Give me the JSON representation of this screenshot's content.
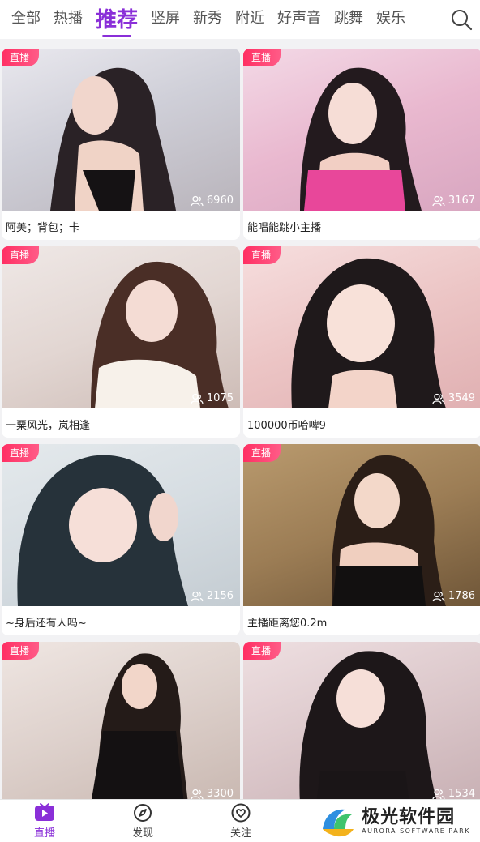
{
  "tabs": [
    {
      "label": "全部",
      "active": false
    },
    {
      "label": "热播",
      "active": false
    },
    {
      "label": "推荐",
      "active": true
    },
    {
      "label": "竖屏",
      "active": false
    },
    {
      "label": "新秀",
      "active": false
    },
    {
      "label": "附近",
      "active": false
    },
    {
      "label": "好声音",
      "active": false
    },
    {
      "label": "跳舞",
      "active": false
    },
    {
      "label": "娱乐",
      "active": false
    }
  ],
  "cards": [
    {
      "badge": "直播",
      "viewers": "6960",
      "title": "阿美；背包；卡"
    },
    {
      "badge": "直播",
      "viewers": "3167",
      "title": "能唱能跳小主播"
    },
    {
      "badge": "直播",
      "viewers": "1075",
      "title": "一粟风光，岚相逢"
    },
    {
      "badge": "直播",
      "viewers": "3549",
      "title": "100000币哈啤9"
    },
    {
      "badge": "直播",
      "viewers": "2156",
      "title": "~身后还有人吗~"
    },
    {
      "badge": "直播",
      "viewers": "1786",
      "title": "主播距离您0.2m"
    },
    {
      "badge": "直播",
      "viewers": "3300",
      "title": ""
    },
    {
      "badge": "直播",
      "viewers": "1534",
      "title": ""
    }
  ],
  "bottom_nav": [
    {
      "label": "直播",
      "icon": "live-tv-icon",
      "active": true
    },
    {
      "label": "发现",
      "icon": "compass-icon",
      "active": false
    },
    {
      "label": "关注",
      "icon": "heart-icon",
      "active": false
    }
  ],
  "watermark": {
    "title": "极光软件园",
    "subtitle": "AURORA SOFTWARE PARK"
  },
  "colors": {
    "accent": "#8a2fd8",
    "badge": "#ff2f63"
  }
}
